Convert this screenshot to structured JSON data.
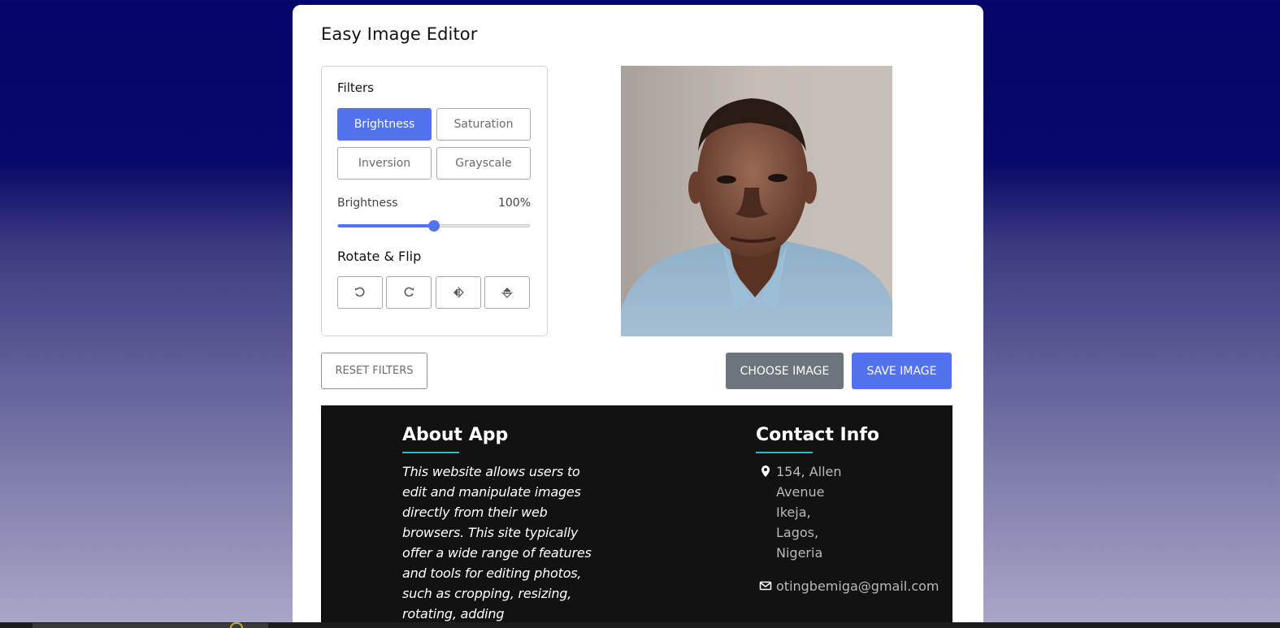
{
  "app": {
    "title": "Easy Image Editor"
  },
  "filters": {
    "heading": "Filters",
    "buttons": [
      {
        "label": "Brightness",
        "active": true
      },
      {
        "label": "Saturation",
        "active": false
      },
      {
        "label": "Inversion",
        "active": false
      },
      {
        "label": "Grayscale",
        "active": false
      }
    ],
    "slider": {
      "name": "Brightness",
      "value_text": "100%",
      "level_fraction": 0.5
    }
  },
  "rotate_flip": {
    "heading": "Rotate & Flip",
    "buttons": [
      {
        "icon": "rotate-left-icon"
      },
      {
        "icon": "rotate-right-icon"
      },
      {
        "icon": "flip-horizontal-icon"
      },
      {
        "icon": "flip-vertical-icon"
      }
    ]
  },
  "actions": {
    "reset_label": "RESET FILTERS",
    "choose_label": "CHOOSE IMAGE",
    "save_label": "SAVE IMAGE"
  },
  "footer": {
    "about": {
      "heading": "About App",
      "text": "This website allows users to edit and manipulate images directly from their web browsers. This site typically offer a wide range of features and tools for editing photos, such as cropping, resizing, rotating, adding"
    },
    "contact": {
      "heading": "Contact Info",
      "address_lines": [
        "154, Allen",
        "Avenue",
        "Ikeja,",
        "Lagos,",
        "Nigeria"
      ],
      "email": "otingbemiga@gmail.com"
    }
  },
  "colors": {
    "accent": "#5372f0",
    "secondary": "#6c757d",
    "footer_bg": "#121212",
    "underline": "#1fc3c9"
  }
}
